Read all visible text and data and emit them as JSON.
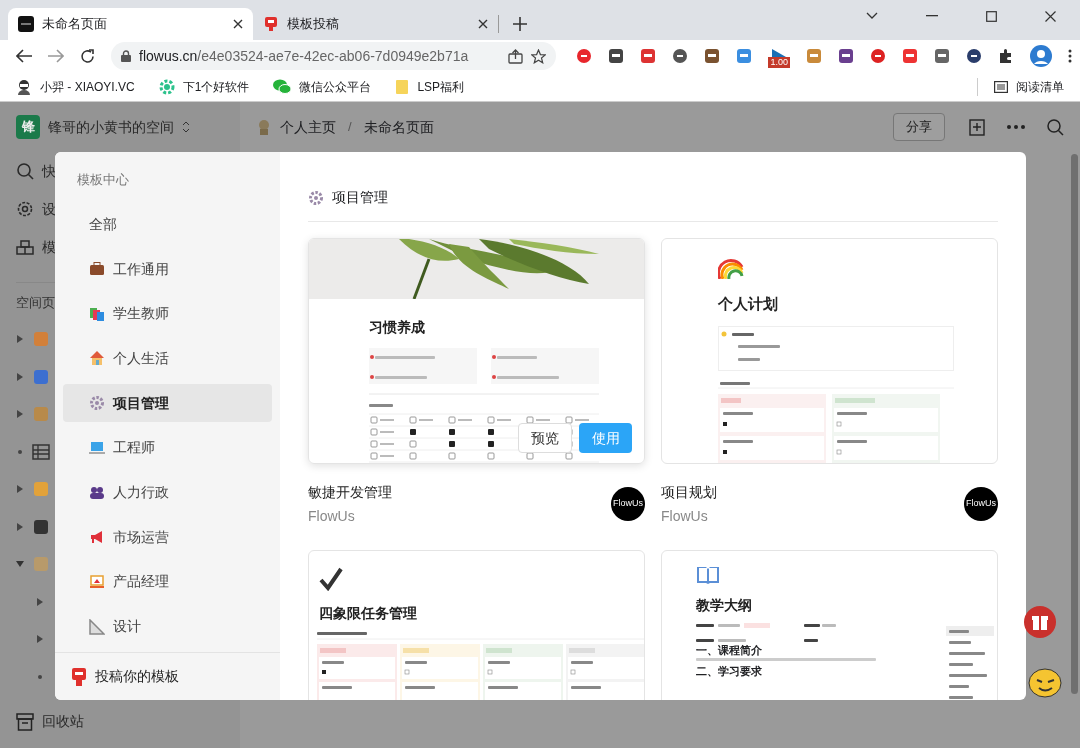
{
  "browser": {
    "tabs": [
      {
        "title": "未命名页面",
        "selected": true
      },
      {
        "title": "模板投稿",
        "selected": false
      }
    ],
    "url": {
      "host": "flowus.cn",
      "path": "/e4e03524-ae7e-42ec-ab06-7d0949e2b71a"
    },
    "extension_badge": "1.00",
    "bookmarks": [
      "小羿 - XIAOYI.VC",
      "下1个好软件",
      "微信公众平台",
      "LSP福利"
    ],
    "reading_list": "阅读清单"
  },
  "app": {
    "logo": "锋",
    "space_name": "锋哥的小黄书的空间",
    "breadcrumb": [
      "个人主页",
      "未命名页面"
    ],
    "breadcrumb_separator": "/",
    "share_button": "分享",
    "sidebar": {
      "items": [
        "快",
        "设",
        "模"
      ],
      "section": "空间页",
      "trash": "回收站"
    }
  },
  "template_center": {
    "title": "模板中心",
    "categories": [
      {
        "label": "全部",
        "selected": false
      },
      {
        "label": "工作通用",
        "selected": false
      },
      {
        "label": "学生教师",
        "selected": false
      },
      {
        "label": "个人生活",
        "selected": false
      },
      {
        "label": "项目管理",
        "selected": true
      },
      {
        "label": "工程师",
        "selected": false
      },
      {
        "label": "人力行政",
        "selected": false
      },
      {
        "label": "市场运营",
        "selected": false
      },
      {
        "label": "产品经理",
        "selected": false
      },
      {
        "label": "设计",
        "selected": false
      }
    ],
    "submit": "投稿你的模板",
    "heading": "项目管理",
    "hover_buttons": [
      "预览",
      "使用"
    ],
    "templates": [
      {
        "name": "敏捷开发管理",
        "author": "FlowUs",
        "logo": "FlowUs",
        "hovered": true,
        "preview": {
          "kind": "habit",
          "title": "习惯养成"
        }
      },
      {
        "name": "项目规划",
        "author": "FlowUs",
        "logo": "FlowUs",
        "hovered": false,
        "preview": {
          "kind": "plan",
          "title": "个人计划"
        }
      },
      {
        "preview": {
          "kind": "quadrant",
          "title": "四象限任务管理"
        }
      },
      {
        "preview": {
          "kind": "syllabus",
          "title": "教学大纲",
          "sections": [
            "一、课程简介",
            "二、学习要求"
          ]
        }
      }
    ]
  }
}
